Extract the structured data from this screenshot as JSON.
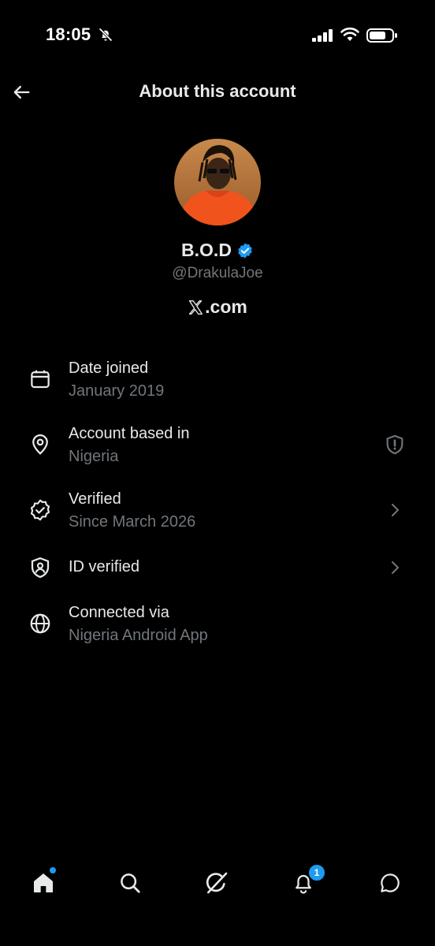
{
  "status_bar": {
    "time": "18:05"
  },
  "header": {
    "title": "About this account"
  },
  "profile": {
    "display_name": "B.O.D",
    "handle": "@DrakulaJoe",
    "platform_text": ".com",
    "verified_color": "#1d9bf0"
  },
  "rows": [
    {
      "icon": "calendar-icon",
      "title": "Date joined",
      "subtitle": "January 2019"
    },
    {
      "icon": "location-pin-icon",
      "title": "Account based in",
      "subtitle": "Nigeria",
      "right_icon": "shield-exclamation-icon"
    },
    {
      "icon": "verified-check-icon",
      "title": "Verified",
      "subtitle": "Since March 2026",
      "right_icon": "chevron-right-icon"
    },
    {
      "icon": "id-shield-icon",
      "title": "ID verified",
      "right_icon": "chevron-right-icon"
    },
    {
      "icon": "globe-icon",
      "title": "Connected via",
      "subtitle": "Nigeria Android App"
    }
  ],
  "bottom_nav": {
    "items": [
      "home-icon",
      "search-icon",
      "grok-icon",
      "notifications-icon",
      "messages-icon"
    ],
    "notification_count": "1"
  },
  "colors": {
    "accent": "#1d9bf0",
    "background": "#000000",
    "secondary_text": "#71767b"
  }
}
